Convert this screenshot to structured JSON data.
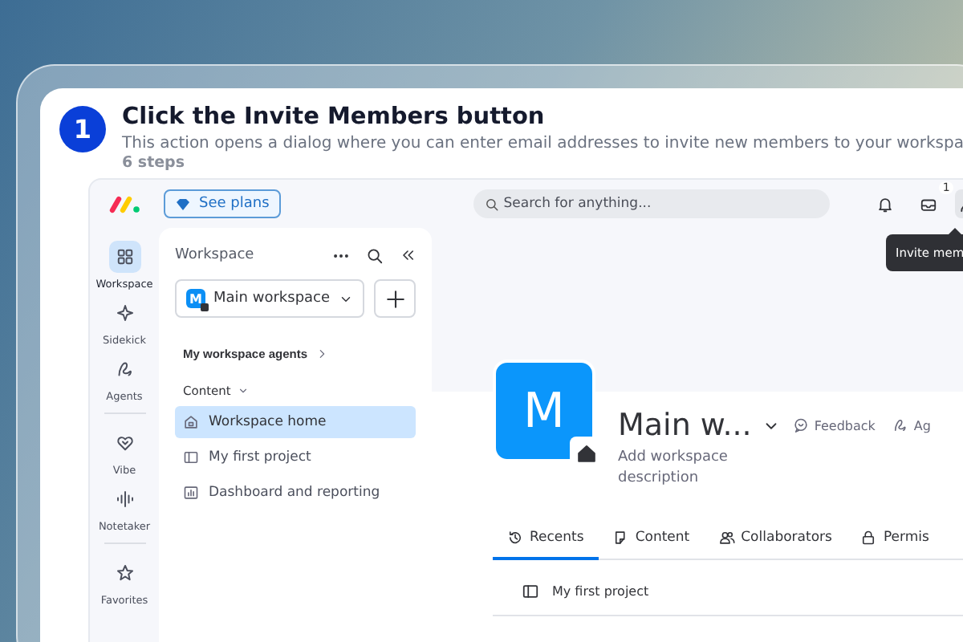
{
  "step": {
    "number": "1",
    "title": "Click the Invite Members button",
    "description": "This action opens a dialog where you can enter email addresses to invite new members to your workspa",
    "count": "6 steps"
  },
  "topbar": {
    "plans_button": "See plans",
    "search": {
      "placeholder": "Search for anything..."
    },
    "inbox_badge": "1",
    "tooltip": "Invite mem"
  },
  "rail": [
    {
      "label": "Workspace",
      "selected": true
    },
    {
      "label": "Sidekick",
      "selected": false
    },
    {
      "label": "Agents",
      "selected": false
    },
    {
      "label": "Vibe",
      "selected": false
    },
    {
      "label": "Notetaker",
      "selected": false
    },
    {
      "label": "Favorites",
      "selected": false
    }
  ],
  "sidebar": {
    "title": "Workspace",
    "workspace": {
      "avatar": "M",
      "name": "Main workspace"
    },
    "agents_link": "My workspace agents",
    "content_label": "Content",
    "items": [
      {
        "label": "Workspace home",
        "selected": true
      },
      {
        "label": "My first project",
        "selected": false
      },
      {
        "label": "Dashboard and reporting",
        "selected": false
      }
    ]
  },
  "main": {
    "avatar": "M",
    "title": "Main w...",
    "actions": [
      {
        "label": "Feedback"
      },
      {
        "label": "Ag"
      }
    ],
    "description": "Add workspace description",
    "tabs": [
      {
        "label": "Recents",
        "selected": true
      },
      {
        "label": "Content",
        "selected": false
      },
      {
        "label": "Collaborators",
        "selected": false
      },
      {
        "label": "Permis",
        "selected": false
      }
    ],
    "recents": [
      {
        "label": "My first project"
      }
    ]
  }
}
